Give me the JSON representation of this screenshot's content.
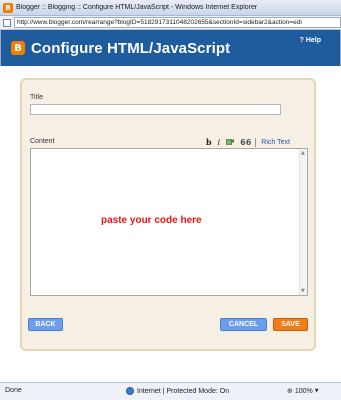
{
  "window": {
    "title": "Blogger :: Blogging :: Configure HTML/JavaScript - Windows Internet Explorer",
    "url": "http://www.blogger.com/rearrange?blogID=5182917311048202655&sectionId=sidebar2&action=edi"
  },
  "dialog": {
    "title": "Configure HTML/JavaScript",
    "help_label": "? Help"
  },
  "form": {
    "title_label": "Title",
    "title_value": "",
    "content_label": "Content",
    "content_text": "paste your code here",
    "toolbar": {
      "bold_label": "b",
      "italic_label": "i",
      "quote_label": "66",
      "rich_text_label": "Rich Text"
    }
  },
  "buttons": {
    "back_label": "BACK",
    "cancel_label": "CANCEL",
    "save_label": "SAVE"
  },
  "status": {
    "done_label": "Done",
    "zone_label": "Internet | Protected Mode: On",
    "zoom_label": "100%"
  },
  "colors": {
    "header_blue": "#1e5c9e",
    "blogger_orange": "#f57d00",
    "panel_beige": "#f6efe3",
    "button_blue": "#6b9ef0",
    "save_orange": "#f07c1a",
    "paste_red": "#ee1111"
  }
}
